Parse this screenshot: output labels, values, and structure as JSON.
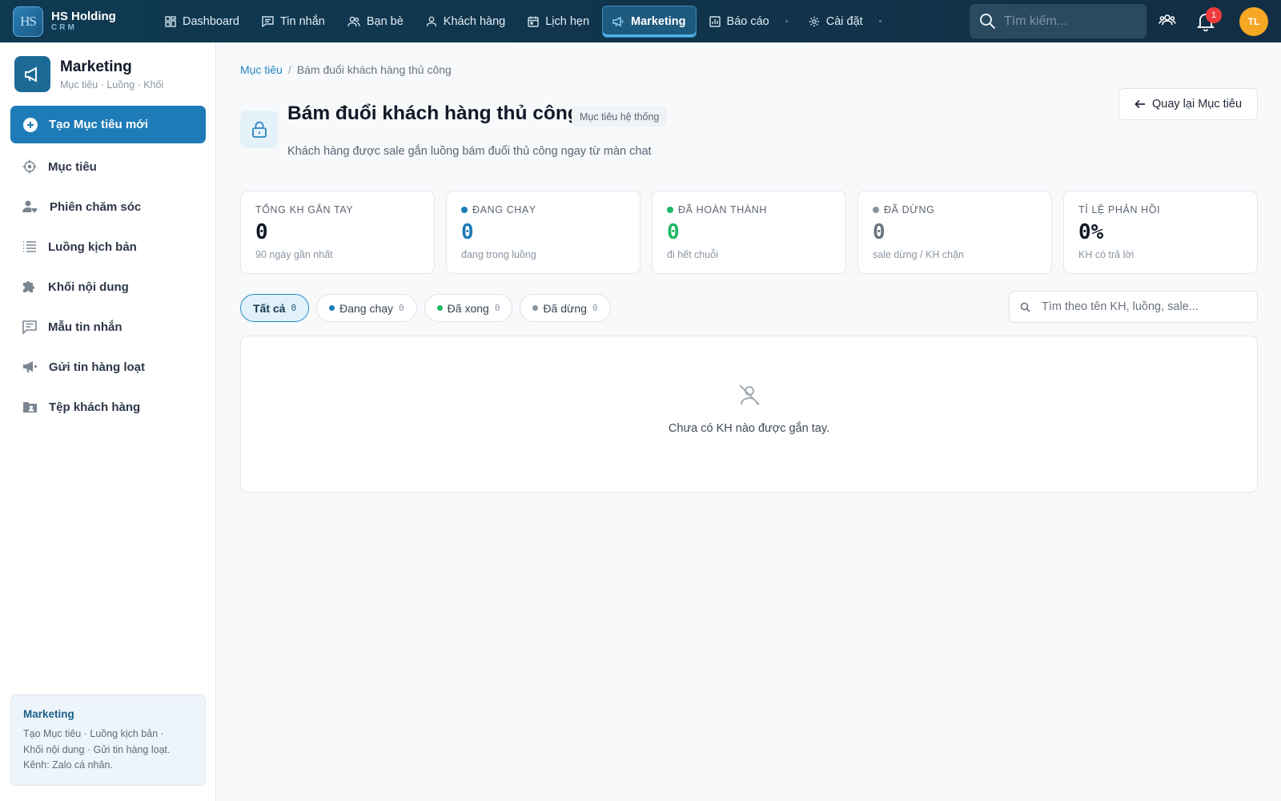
{
  "brand": {
    "logo": "HS",
    "name": "HS Holding",
    "sub": "CRM"
  },
  "nav": {
    "items": [
      {
        "label": "Dashboard",
        "icon": "grid-icon"
      },
      {
        "label": "Tin nhắn",
        "icon": "message-icon"
      },
      {
        "label": "Bạn bè",
        "icon": "friends-icon"
      },
      {
        "label": "Khách hàng",
        "icon": "user-icon"
      },
      {
        "label": "Lịch hẹn",
        "icon": "calendar-icon"
      },
      {
        "label": "Marketing",
        "icon": "megaphone-icon",
        "active": true
      },
      {
        "label": "Báo cáo",
        "icon": "chart-icon"
      },
      {
        "label": "Cài đặt",
        "icon": "gear-icon"
      }
    ],
    "search_placeholder": "Tìm kiếm...",
    "notification_count": "1",
    "avatar_initials": "TL"
  },
  "sidebar": {
    "title": "Marketing",
    "subtitle": "Mục tiêu · Luồng · Khối",
    "create_label": "Tạo Mục tiêu mới",
    "items": [
      {
        "label": "Mục tiêu",
        "icon": "target-icon"
      },
      {
        "label": "Phiên chăm sóc",
        "icon": "user-heart-icon"
      },
      {
        "label": "Luồng kịch bản",
        "icon": "list-icon"
      },
      {
        "label": "Khối nội dung",
        "icon": "puzzle-icon"
      },
      {
        "label": "Mẫu tin nhắn",
        "icon": "message-template-icon"
      },
      {
        "label": "Gửi tin hàng loạt",
        "icon": "broadcast-icon"
      },
      {
        "label": "Tệp khách hàng",
        "icon": "folder-user-icon"
      }
    ],
    "info": {
      "title": "Marketing",
      "line1": "Tạo Mục tiêu · Luồng kịch bản ·",
      "line2": "Khối nội dung · Gửi tin hàng loạt.",
      "line3": "Kênh: Zalo cá nhân."
    }
  },
  "main": {
    "breadcrumb": {
      "parent": "Mục tiêu",
      "current": "Bám đuổi khách hàng thủ công"
    },
    "title": "Bám đuổi khách hàng thủ công",
    "badge": "Mục tiêu hệ thống",
    "description": "Khách hàng được sale gắn luồng bám đuổi thủ công ngay từ màn chat",
    "back_label": "Quay lại Mục tiêu",
    "stats": [
      {
        "label": "TỔNG KH GẮN TAY",
        "value": "0",
        "sub": "90 ngày gần nhất",
        "dot": "",
        "color": "#111827"
      },
      {
        "label": "ĐANG CHẠY",
        "value": "0",
        "sub": "đang trong luồng",
        "dot": "#1d7bb8",
        "color": "#1d7bb8"
      },
      {
        "label": "ĐÃ HOÀN THÀNH",
        "value": "0",
        "sub": "đi hết chuỗi",
        "dot": "#1fb864",
        "color": "#1fb864"
      },
      {
        "label": "ĐÃ DỪNG",
        "value": "0",
        "sub": "sale dừng / KH chặn",
        "dot": "#8a94a0",
        "color": "#6b7480"
      },
      {
        "label": "TỈ LỆ PHẢN HỒI",
        "value": "0%",
        "sub": "KH có trả lời",
        "dot": "",
        "color": "#111827"
      }
    ],
    "filters": [
      {
        "label": "Tất cả",
        "count": "0",
        "dot": "",
        "active": true
      },
      {
        "label": "Đang chạy",
        "count": "0",
        "dot": "#1d7bb8"
      },
      {
        "label": "Đã xong",
        "count": "0",
        "dot": "#1fb864"
      },
      {
        "label": "Đã dừng",
        "count": "0",
        "dot": "#8a94a0"
      }
    ],
    "search_placeholder": "Tìm theo tên KH, luồng, sale...",
    "empty_text": "Chưa có KH nào được gắn tay."
  }
}
